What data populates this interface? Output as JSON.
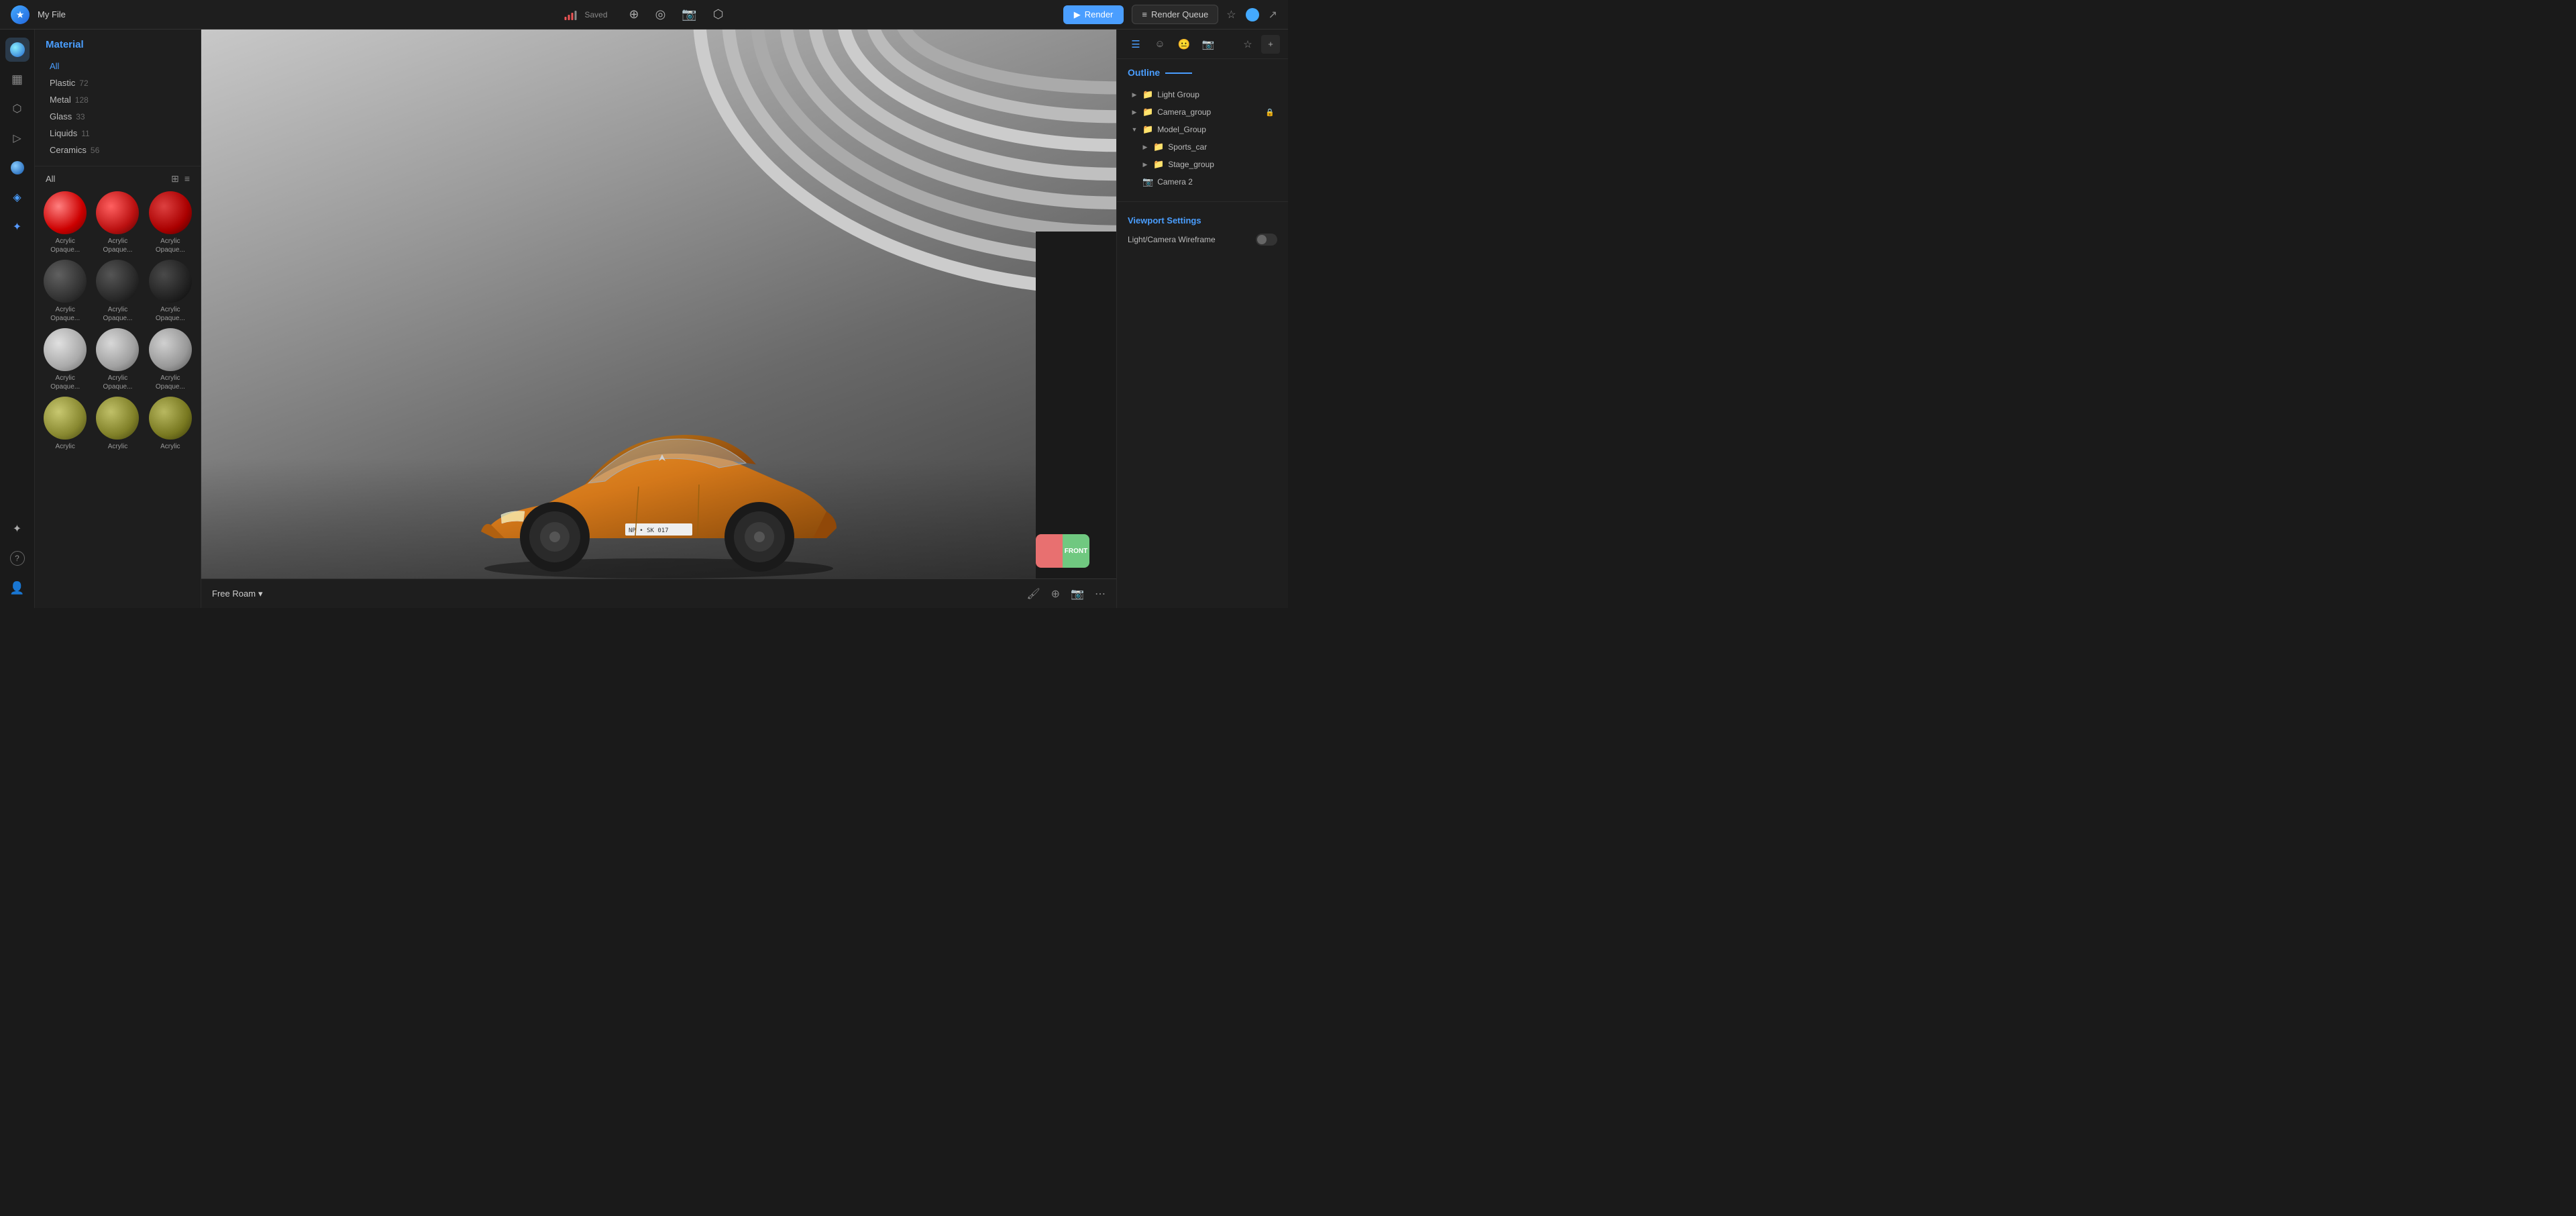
{
  "topbar": {
    "logo": "★",
    "title": "My File",
    "saved_label": "Saved",
    "render_btn": "Render",
    "render_queue_btn": "Render Queue"
  },
  "icon_sidebar": {
    "items": [
      {
        "name": "sphere-icon",
        "icon": "⬤",
        "active": true
      },
      {
        "name": "layers-icon",
        "icon": "▦",
        "active": false
      },
      {
        "name": "cube-icon",
        "icon": "⬡",
        "active": false
      },
      {
        "name": "shape-icon",
        "icon": "▷",
        "active": false
      },
      {
        "name": "globe-icon",
        "icon": "◉",
        "active": false
      },
      {
        "name": "water-icon",
        "icon": "◈",
        "active": false
      },
      {
        "name": "lightning-icon",
        "icon": "✦",
        "active": false
      }
    ],
    "bottom_items": [
      {
        "name": "sparkle-icon",
        "icon": "✦"
      },
      {
        "name": "help-icon",
        "icon": "?"
      },
      {
        "name": "user-icon",
        "icon": "👤"
      }
    ]
  },
  "material_panel": {
    "title": "Material",
    "categories": [
      {
        "name": "All",
        "count": null,
        "active": true
      },
      {
        "name": "Plastic",
        "count": "72",
        "active": false
      },
      {
        "name": "Metal",
        "count": "128",
        "active": false
      },
      {
        "name": "Glass",
        "count": "33",
        "active": false
      },
      {
        "name": "Liquids",
        "count": "11",
        "active": false
      },
      {
        "name": "Ceramics",
        "count": "56",
        "active": false
      }
    ],
    "grid_label": "All",
    "materials": [
      {
        "label": "Acrylic Opaque...",
        "sphere_class": "sphere-red-1"
      },
      {
        "label": "Acrylic Opaque...",
        "sphere_class": "sphere-red-2"
      },
      {
        "label": "Acrylic Opaque...",
        "sphere_class": "sphere-red-3"
      },
      {
        "label": "Acrylic Opaque...",
        "sphere_class": "sphere-dark-1"
      },
      {
        "label": "Acrylic Opaque...",
        "sphere_class": "sphere-dark-2"
      },
      {
        "label": "Acrylic Opaque...",
        "sphere_class": "sphere-dark-3"
      },
      {
        "label": "Acrylic Opaque...",
        "sphere_class": "sphere-silver-1"
      },
      {
        "label": "Acrylic Opaque...",
        "sphere_class": "sphere-silver-2"
      },
      {
        "label": "Acrylic Opaque...",
        "sphere_class": "sphere-silver-3"
      },
      {
        "label": "Acrylic",
        "sphere_class": "sphere-olive-1"
      },
      {
        "label": "Acrylic",
        "sphere_class": "sphere-olive-2"
      },
      {
        "label": "Acrylic",
        "sphere_class": "sphere-olive-3"
      }
    ]
  },
  "viewport": {
    "mode_label": "Free Roam",
    "front_label": "FRONT"
  },
  "right_panel": {
    "outline_title": "Outline",
    "tree_items": [
      {
        "label": "Light Group",
        "type": "group",
        "indent": 0,
        "expanded": false,
        "locked": false
      },
      {
        "label": "Camera_group",
        "type": "group",
        "indent": 0,
        "expanded": false,
        "locked": true
      },
      {
        "label": "Model_Group",
        "type": "group",
        "indent": 0,
        "expanded": true,
        "locked": false
      },
      {
        "label": "Sports_car",
        "type": "group",
        "indent": 1,
        "expanded": false,
        "locked": false
      },
      {
        "label": "Stage_group",
        "type": "group",
        "indent": 1,
        "expanded": false,
        "locked": false
      },
      {
        "label": "Camera 2",
        "type": "camera",
        "indent": 0,
        "expanded": false,
        "locked": false
      }
    ],
    "viewport_settings_title": "Viewport Settings",
    "settings": [
      {
        "label": "Light/Camera Wireframe",
        "value": false
      }
    ]
  }
}
